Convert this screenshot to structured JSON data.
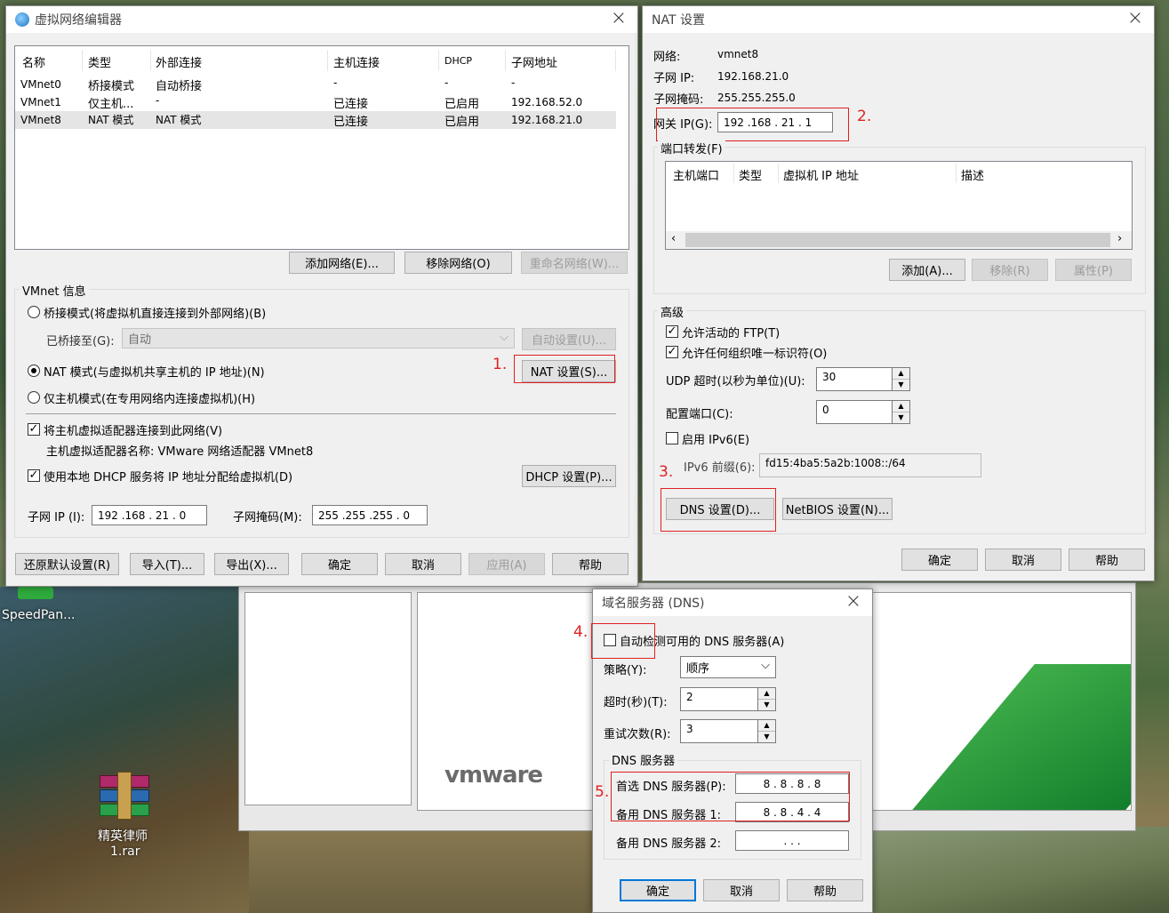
{
  "desktop": {
    "icons": [
      {
        "label": "SpeedPan..."
      },
      {
        "label_line1": "精英律师",
        "label_line2": "1.rar"
      }
    ]
  },
  "bgwin": {
    "logo": "vmware"
  },
  "vne": {
    "title": "虚拟网络编辑器",
    "cols": [
      "名称",
      "类型",
      "外部连接",
      "主机连接",
      "DHCP",
      "子网地址"
    ],
    "rows": [
      [
        "VMnet0",
        "桥接模式",
        "自动桥接",
        "-",
        "-",
        "-"
      ],
      [
        "VMnet1",
        "仅主机...",
        "-",
        "已连接",
        "已启用",
        "192.168.52.0"
      ],
      [
        "VMnet8",
        "NAT 模式",
        "NAT 模式",
        "已连接",
        "已启用",
        "192.168.21.0"
      ]
    ],
    "add_net": "添加网络(E)...",
    "remove_net": "移除网络(O)",
    "rename_net": "重命名网络(W)...",
    "vmnet_info": "VMnet 信息",
    "bridge_mode": "桥接模式(将虚拟机直接连接到外部网络)(B)",
    "bridged_to": "已桥接至(G):",
    "bridged_value": "自动",
    "auto_settings": "自动设置(U)...",
    "nat_mode": "NAT 模式(与虚拟机共享主机的 IP 地址)(N)",
    "nat_settings": "NAT 设置(S)...",
    "host_only": "仅主机模式(在专用网络内连接虚拟机)(H)",
    "connect_adapter": "将主机虚拟适配器连接到此网络(V)",
    "adapter_name": "主机虚拟适配器名称: VMware 网络适配器 VMnet8",
    "use_dhcp": "使用本地 DHCP 服务将 IP 地址分配给虚拟机(D)",
    "dhcp_settings": "DHCP 设置(P)...",
    "subnet_ip_label": "子网 IP (I):",
    "subnet_ip": "192 .168 . 21  .  0",
    "subnet_mask_label": "子网掩码(M):",
    "subnet_mask": "255 .255 .255 .  0",
    "restore": "还原默认设置(R)",
    "import": "导入(T)...",
    "export": "导出(X)...",
    "ok": "确定",
    "cancel": "取消",
    "apply": "应用(A)",
    "help": "帮助",
    "mark1": "1."
  },
  "nat": {
    "title": "NAT 设置",
    "network_label": "网络:",
    "network": "vmnet8",
    "subnet_ip_label": "子网 IP:",
    "subnet_ip": "192.168.21.0",
    "subnet_mask_label": "子网掩码:",
    "subnet_mask": "255.255.255.0",
    "gateway_label": "网关 IP(G):",
    "gateway": "192 .168 . 21  .  1",
    "mark2": "2.",
    "port_fwd": "端口转发(F)",
    "pf_cols": [
      "主机端口",
      "类型",
      "虚拟机 IP 地址",
      "描述"
    ],
    "add": "添加(A)...",
    "remove": "移除(R)",
    "props": "属性(P)",
    "advanced": "高级",
    "allow_ftp": "允许活动的 FTP(T)",
    "allow_uid": "允许任何组织唯一标识符(O)",
    "udp_timeout_label": "UDP 超时(以秒为单位)(U):",
    "udp_timeout": "30",
    "config_port_label": "配置端口(C):",
    "config_port": "0",
    "enable_ipv6": "启用 IPv6(E)",
    "ipv6_prefix_label": "IPv6 前缀(6):",
    "ipv6_prefix": "fd15:4ba5:5a2b:1008::/64",
    "mark3": "3.",
    "dns_settings": "DNS 设置(D)...",
    "netbios_settings": "NetBIOS 设置(N)...",
    "ok": "确定",
    "cancel": "取消",
    "help": "帮助"
  },
  "dns": {
    "title": "域名服务器 (DNS)",
    "mark4": "4.",
    "auto_detect": "自动检测可用的 DNS 服务器(A)",
    "policy_label": "策略(Y):",
    "policy": "顺序",
    "timeout_label": "超时(秒)(T):",
    "timeout": "2",
    "retries_label": "重试次数(R):",
    "retries": "3",
    "servers_group": "DNS 服务器",
    "mark5": "5.",
    "preferred_label": "首选 DNS 服务器(P):",
    "preferred": "8  .  8  .  8  .  8",
    "alt1_label": "备用 DNS 服务器 1:",
    "alt1": "8  .  8  .  4  .  4",
    "alt2_label": "备用 DNS 服务器 2:",
    "alt2": ".     .     .",
    "ok": "确定",
    "cancel": "取消",
    "help": "帮助"
  },
  "colors": {
    "accent_red": "#e02020",
    "selection": "#e5e5e5"
  }
}
